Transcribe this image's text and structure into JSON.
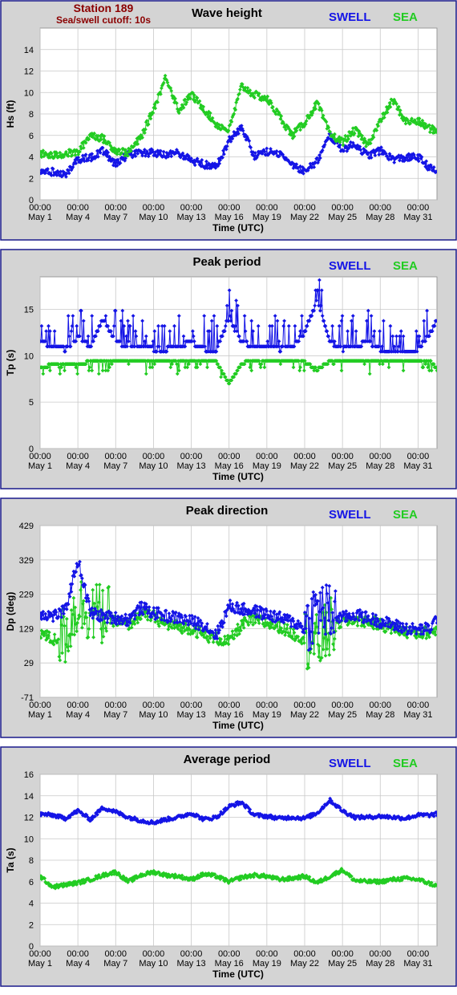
{
  "station": {
    "title": "Station 189",
    "subtitle": "Sea/swell cutoff: 10s",
    "title_color": "#8b0000"
  },
  "colors": {
    "swell": "#1414e6",
    "sea": "#22cc22",
    "panel_border": "#1a1a8c",
    "plot_bg": "#d4d4d4",
    "plot_area": "#ffffff",
    "grid": "#c8c8c8"
  },
  "legend": {
    "swell": "SWELL",
    "sea": "SEA"
  },
  "x_axis": {
    "xlabel": "Time (UTC)",
    "range_days": [
      1,
      32.5
    ],
    "ticks": [
      {
        "day": 1,
        "time": "00:00",
        "date": "May 1"
      },
      {
        "day": 4,
        "time": "00:00",
        "date": "May 4"
      },
      {
        "day": 7,
        "time": "00:00",
        "date": "May 7"
      },
      {
        "day": 10,
        "time": "00:00",
        "date": "May 10"
      },
      {
        "day": 13,
        "time": "00:00",
        "date": "May 13"
      },
      {
        "day": 16,
        "time": "00:00",
        "date": "May 16"
      },
      {
        "day": 19,
        "time": "00:00",
        "date": "May 19"
      },
      {
        "day": 22,
        "time": "00:00",
        "date": "May 22"
      },
      {
        "day": 25,
        "time": "00:00",
        "date": "May 25"
      },
      {
        "day": 28,
        "time": "00:00",
        "date": "May 28"
      },
      {
        "day": 31,
        "time": "00:00",
        "date": "May 31"
      }
    ]
  },
  "chart_data": [
    {
      "type": "line",
      "title": "Wave height",
      "ylabel": "Hs (ft)",
      "ylim": [
        0,
        16
      ],
      "yticks": [
        "0",
        "2",
        "4",
        "6",
        "8",
        "10",
        "12",
        "14"
      ],
      "grid": true,
      "legend_position": "top-right",
      "series": [
        {
          "name": "SWELL",
          "x": [
            1,
            2,
            3,
            4,
            5,
            6,
            7,
            8,
            9,
            10,
            11,
            12,
            13,
            14,
            15,
            16,
            17,
            18,
            19,
            20,
            21,
            22,
            23,
            24,
            25,
            26,
            27,
            28,
            29,
            30,
            31,
            32,
            32.5
          ],
          "y": [
            2.8,
            2.6,
            2.3,
            3.8,
            3.9,
            4.6,
            3.3,
            4.2,
            4.3,
            4.4,
            4.1,
            4.4,
            3.7,
            3.3,
            3.1,
            5.5,
            6.8,
            4.1,
            4.5,
            4.3,
            3.3,
            2.7,
            3.6,
            6.0,
            4.7,
            5.2,
            4.1,
            4.6,
            3.8,
            3.9,
            4.0,
            2.9,
            2.6
          ]
        },
        {
          "name": "SEA",
          "x": [
            1,
            2,
            3,
            4,
            5,
            6,
            7,
            8,
            9,
            10,
            11,
            12,
            13,
            14,
            15,
            16,
            17,
            18,
            19,
            20,
            21,
            22,
            23,
            24,
            25,
            26,
            27,
            28,
            29,
            30,
            31,
            32,
            32.5
          ],
          "y": [
            4.3,
            4.1,
            4.3,
            4.4,
            6.1,
            5.7,
            4.6,
            4.4,
            5.8,
            8.4,
            11.5,
            8.3,
            9.8,
            8.5,
            7.0,
            6.5,
            10.6,
            9.8,
            9.4,
            7.8,
            6.0,
            7.2,
            9.0,
            6.1,
            5.4,
            6.5,
            5.1,
            7.3,
            9.3,
            7.3,
            7.3,
            6.6,
            6.4
          ]
        }
      ]
    },
    {
      "type": "line",
      "title": "Peak period",
      "ylabel": "Tp (s)",
      "ylim": [
        0,
        18.5
      ],
      "yticks": [
        "0",
        "5",
        "10",
        "15"
      ],
      "grid": true,
      "legend_position": "top-right",
      "series": [
        {
          "name": "SWELL",
          "x": [
            1,
            2,
            3,
            4,
            5,
            6,
            7,
            8,
            9,
            10,
            11,
            12,
            13,
            14,
            15,
            16,
            17,
            18,
            19,
            20,
            21,
            22,
            23,
            24,
            25,
            26,
            27,
            28,
            29,
            30,
            31,
            32,
            32.5
          ],
          "y": [
            11.5,
            11.0,
            10.7,
            12.0,
            11.0,
            14.0,
            11.5,
            11.0,
            11.0,
            10.7,
            10.7,
            11.0,
            11.5,
            10.7,
            10.7,
            14.0,
            11.5,
            11.0,
            11.0,
            10.7,
            11.0,
            12.5,
            16.0,
            11.5,
            10.7,
            11.0,
            11.5,
            10.7,
            10.7,
            10.7,
            10.7,
            12.5,
            14.0
          ]
        },
        {
          "name": "SEA",
          "x": [
            1,
            2,
            3,
            4,
            5,
            6,
            7,
            8,
            9,
            10,
            11,
            12,
            13,
            14,
            15,
            16,
            17,
            18,
            19,
            20,
            21,
            22,
            23,
            24,
            25,
            26,
            27,
            28,
            29,
            30,
            31,
            32,
            32.5
          ],
          "y": [
            8.8,
            9.0,
            9.2,
            9.0,
            9.4,
            9.3,
            9.3,
            9.3,
            9.3,
            9.3,
            9.5,
            9.3,
            9.3,
            9.3,
            9.3,
            7.0,
            9.2,
            9.5,
            9.5,
            9.5,
            9.4,
            9.3,
            8.5,
            9.4,
            9.4,
            9.4,
            9.3,
            9.4,
            9.4,
            9.5,
            9.4,
            9.4,
            8.5
          ]
        }
      ]
    },
    {
      "type": "line",
      "title": "Peak direction",
      "ylabel": "Dp (deg)",
      "ylim": [
        -71,
        429
      ],
      "yticks": [
        "-71",
        "29",
        "129",
        "229",
        "329",
        "429"
      ],
      "grid": true,
      "legend_position": "top-right",
      "series": [
        {
          "name": "SWELL",
          "x": [
            1,
            2,
            3,
            4,
            5,
            6,
            7,
            8,
            9,
            10,
            11,
            12,
            13,
            14,
            15,
            16,
            17,
            18,
            19,
            20,
            21,
            22,
            23,
            24,
            25,
            26,
            27,
            28,
            29,
            30,
            31,
            32,
            32.5
          ],
          "y": [
            175,
            165,
            180,
            330,
            175,
            165,
            160,
            155,
            190,
            175,
            165,
            160,
            150,
            140,
            110,
            195,
            185,
            180,
            170,
            160,
            150,
            130,
            190,
            170,
            160,
            170,
            160,
            150,
            140,
            130,
            125,
            130,
            160
          ]
        },
        {
          "name": "SEA",
          "x": [
            1,
            2,
            3,
            4,
            5,
            6,
            7,
            8,
            9,
            10,
            11,
            12,
            13,
            14,
            15,
            16,
            17,
            18,
            19,
            20,
            21,
            22,
            23,
            24,
            25,
            26,
            27,
            28,
            29,
            30,
            31,
            32,
            32.5
          ],
          "y": [
            120,
            95,
            110,
            200,
            180,
            170,
            150,
            140,
            170,
            165,
            140,
            135,
            130,
            110,
            100,
            90,
            140,
            155,
            145,
            135,
            115,
            100,
            80,
            130,
            150,
            155,
            150,
            140,
            130,
            120,
            115,
            120,
            125
          ]
        }
      ]
    },
    {
      "type": "line",
      "title": "Average period",
      "ylabel": "Ta (s)",
      "ylim": [
        0,
        16
      ],
      "yticks": [
        "0",
        "2",
        "4",
        "6",
        "8",
        "10",
        "12",
        "14",
        "16"
      ],
      "grid": true,
      "legend_position": "top-right",
      "series": [
        {
          "name": "SWELL",
          "x": [
            1,
            2,
            3,
            4,
            5,
            6,
            7,
            8,
            9,
            10,
            11,
            12,
            13,
            14,
            15,
            16,
            17,
            18,
            19,
            20,
            21,
            22,
            23,
            24,
            25,
            26,
            27,
            28,
            29,
            30,
            31,
            32,
            32.5
          ],
          "y": [
            12.3,
            12.2,
            11.9,
            12.6,
            11.8,
            12.9,
            12.5,
            12.0,
            11.7,
            11.5,
            11.8,
            12.0,
            12.4,
            11.8,
            12.0,
            13.0,
            13.4,
            12.2,
            12.1,
            11.9,
            12.0,
            11.9,
            12.4,
            13.6,
            12.6,
            12.0,
            12.0,
            12.1,
            12.0,
            11.9,
            12.2,
            12.2,
            12.3
          ]
        },
        {
          "name": "SEA",
          "x": [
            1,
            2,
            3,
            4,
            5,
            6,
            7,
            8,
            9,
            10,
            11,
            12,
            13,
            14,
            15,
            16,
            17,
            18,
            19,
            20,
            21,
            22,
            23,
            24,
            25,
            26,
            27,
            28,
            29,
            30,
            31,
            32,
            32.5
          ],
          "y": [
            6.5,
            5.5,
            5.7,
            5.9,
            6.2,
            6.6,
            6.9,
            6.0,
            6.6,
            6.9,
            6.6,
            6.5,
            6.2,
            6.7,
            6.5,
            6.0,
            6.4,
            6.6,
            6.5,
            6.2,
            6.3,
            6.5,
            5.9,
            6.5,
            7.1,
            6.1,
            6.0,
            6.0,
            6.2,
            6.3,
            6.2,
            5.8,
            5.6
          ]
        }
      ]
    }
  ]
}
